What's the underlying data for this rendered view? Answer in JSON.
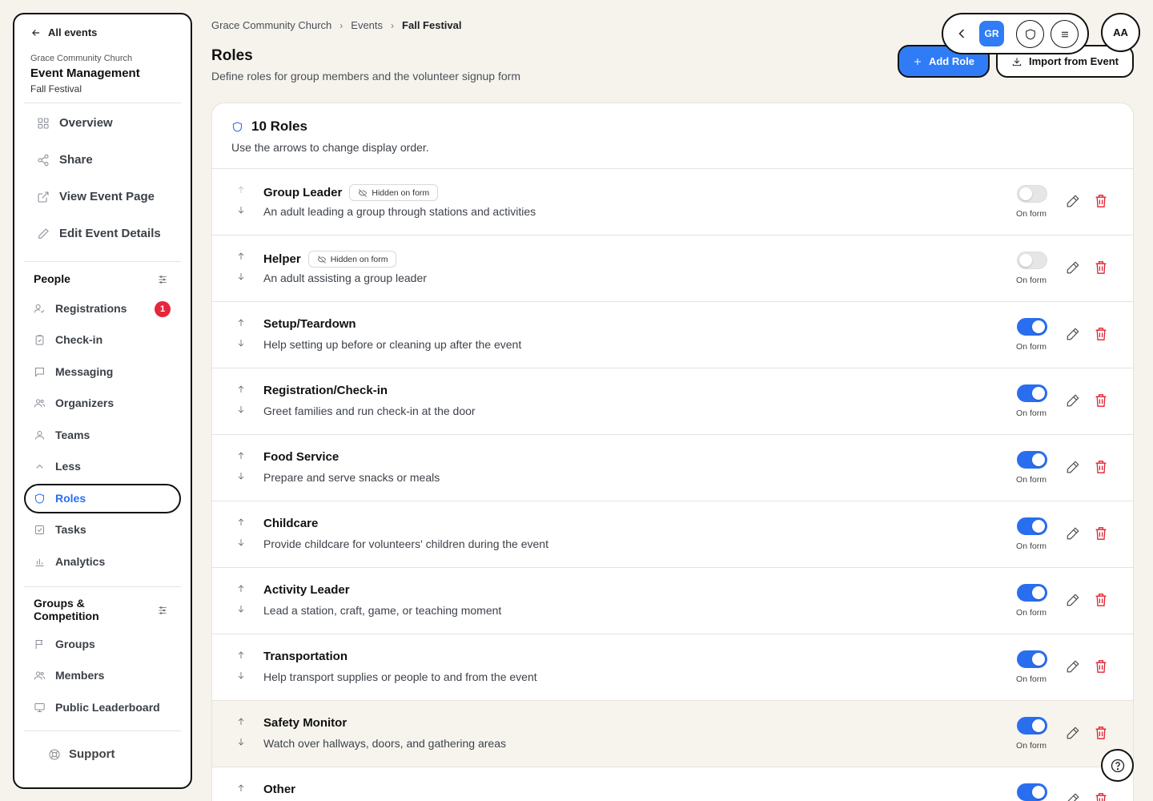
{
  "sidebar": {
    "back_label": "All events",
    "org_name": "Grace Community Church",
    "app_title": "Event Management",
    "event_name": "Fall Festival",
    "top_nav": [
      {
        "label": "Overview",
        "icon": "grid-icon"
      },
      {
        "label": "Share",
        "icon": "share-icon"
      },
      {
        "label": "View Event Page",
        "icon": "external-link-icon"
      },
      {
        "label": "Edit Event Details",
        "icon": "pencil-icon"
      }
    ],
    "people_section": {
      "title": "People",
      "items": [
        {
          "label": "Registrations",
          "icon": "user-check-icon",
          "badge": "1"
        },
        {
          "label": "Check-in",
          "icon": "clipboard-check-icon"
        },
        {
          "label": "Messaging",
          "icon": "message-icon"
        },
        {
          "label": "Organizers",
          "icon": "users-icon"
        },
        {
          "label": "Teams",
          "icon": "user-icon"
        },
        {
          "label": "Less",
          "icon": "chevron-up-icon"
        },
        {
          "label": "Roles",
          "icon": "shield-icon",
          "active": true
        },
        {
          "label": "Tasks",
          "icon": "checkbox-icon"
        },
        {
          "label": "Analytics",
          "icon": "bar-chart-icon"
        }
      ]
    },
    "groups_section": {
      "title": "Groups & Competition",
      "items": [
        {
          "label": "Groups",
          "icon": "flag-icon"
        },
        {
          "label": "Members",
          "icon": "users-icon"
        },
        {
          "label": "Public Leaderboard",
          "icon": "monitor-icon"
        }
      ]
    },
    "support_label": "Support"
  },
  "breadcrumb": [
    "Grace Community Church",
    "Events",
    "Fall Festival"
  ],
  "header": {
    "title": "Roles",
    "subtitle": "Define roles for group members and the volunteer signup form",
    "add_button": "Add Role",
    "import_button": "Import from Event"
  },
  "floating_bar": {
    "workspace_initials": "GR",
    "avatar_initials": "AA"
  },
  "roles_card": {
    "title": "10 Roles",
    "subtitle": "Use the arrows to change display order.",
    "toggle_label": "On form",
    "hidden_label": "Hidden on form",
    "roles": [
      {
        "name": "Group Leader",
        "description": "An adult leading a group through stations and activities",
        "on_form": false,
        "hidden_on_form": true
      },
      {
        "name": "Helper",
        "description": "An adult assisting a group leader",
        "on_form": false,
        "hidden_on_form": true
      },
      {
        "name": "Setup/Teardown",
        "description": "Help setting up before or cleaning up after the event",
        "on_form": true,
        "hidden_on_form": false
      },
      {
        "name": "Registration/Check-in",
        "description": "Greet families and run check-in at the door",
        "on_form": true,
        "hidden_on_form": false
      },
      {
        "name": "Food Service",
        "description": "Prepare and serve snacks or meals",
        "on_form": true,
        "hidden_on_form": false
      },
      {
        "name": "Childcare",
        "description": "Provide childcare for volunteers' children during the event",
        "on_form": true,
        "hidden_on_form": false
      },
      {
        "name": "Activity Leader",
        "description": "Lead a station, craft, game, or teaching moment",
        "on_form": true,
        "hidden_on_form": false
      },
      {
        "name": "Transportation",
        "description": "Help transport supplies or people to and from the event",
        "on_form": true,
        "hidden_on_form": false
      },
      {
        "name": "Safety Monitor",
        "description": "Watch over hallways, doors, and gathering areas",
        "on_form": true,
        "hidden_on_form": false
      },
      {
        "name": "Other",
        "description": "",
        "on_form": true,
        "hidden_on_form": false
      }
    ]
  },
  "colors": {
    "accent": "#2a6ef0",
    "primary_button": "#2f7cf6",
    "danger": "#e0202e",
    "badge": "#e5263b",
    "page_bg": "#f6f3ed"
  }
}
